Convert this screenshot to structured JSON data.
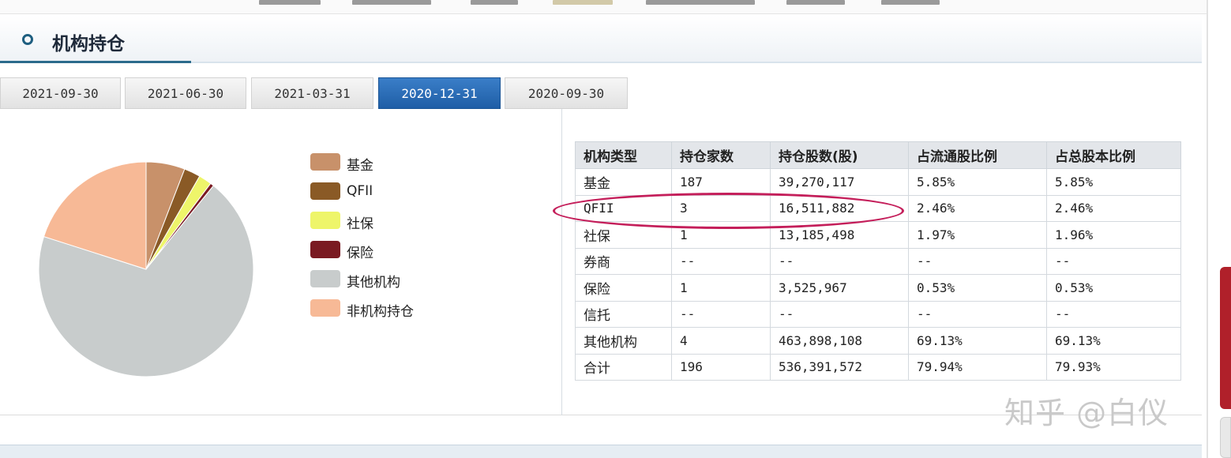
{
  "section": {
    "title": "机构持仓"
  },
  "tabs": [
    {
      "label": "2021-09-30",
      "active": false
    },
    {
      "label": "2021-06-30",
      "active": false
    },
    {
      "label": "2021-03-31",
      "active": false
    },
    {
      "label": "2020-12-31",
      "active": true
    },
    {
      "label": "2020-09-30",
      "active": false
    }
  ],
  "legend": [
    {
      "label": "基金",
      "color": "#c8916a"
    },
    {
      "label": "QFII",
      "color": "#8a5a26"
    },
    {
      "label": "社保",
      "color": "#eef56a"
    },
    {
      "label": "保险",
      "color": "#7a1a22"
    },
    {
      "label": "其他机构",
      "color": "#c8cccc"
    },
    {
      "label": "非机构持仓",
      "color": "#f7b996"
    }
  ],
  "pie": {
    "slices": [
      {
        "name": "基金",
        "percent": 5.85,
        "color": "#c8916a"
      },
      {
        "name": "QFII",
        "percent": 2.46,
        "color": "#8a5a26"
      },
      {
        "name": "社保",
        "percent": 1.96,
        "color": "#eef56a"
      },
      {
        "name": "保险",
        "percent": 0.53,
        "color": "#7a1a22"
      },
      {
        "name": "其他机构",
        "percent": 69.13,
        "color": "#c8cccc"
      },
      {
        "name": "非机构持仓",
        "percent": 20.07,
        "color": "#f7b996"
      }
    ]
  },
  "table": {
    "headers": [
      "机构类型",
      "持仓家数",
      "持仓股数(股)",
      "占流通股比例",
      "占总股本比例"
    ],
    "rows": [
      [
        "基金",
        "187",
        "39,270,117",
        "5.85%",
        "5.85%"
      ],
      [
        "QFII",
        "3",
        "16,511,882",
        "2.46%",
        "2.46%"
      ],
      [
        "社保",
        "1",
        "13,185,498",
        "1.97%",
        "1.96%"
      ],
      [
        "券商",
        "--",
        "--",
        "--",
        "--"
      ],
      [
        "保险",
        "1",
        "3,525,967",
        "0.53%",
        "0.53%"
      ],
      [
        "信托",
        "--",
        "--",
        "--",
        "--"
      ],
      [
        "其他机构",
        "4",
        "463,898,108",
        "69.13%",
        "69.13%"
      ],
      [
        "合计",
        "196",
        "536,391,572",
        "79.94%",
        "79.93%"
      ]
    ]
  },
  "watermark": "知乎 @白仪"
}
